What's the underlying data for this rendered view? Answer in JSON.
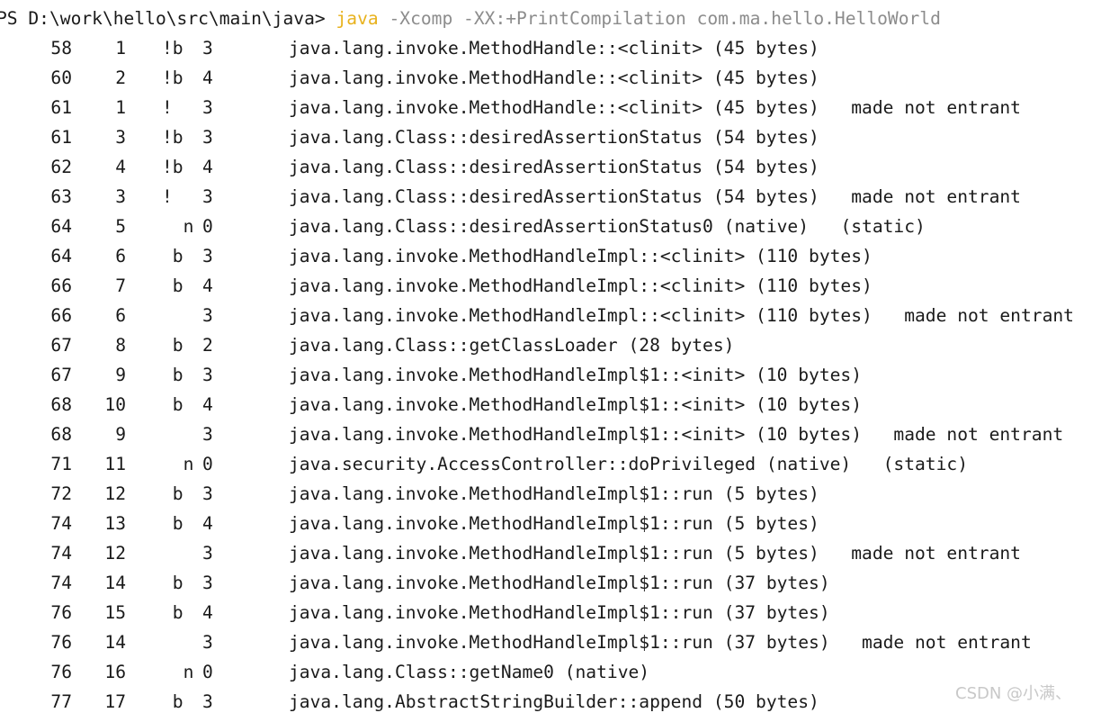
{
  "command": {
    "prompt": "PS D:\\work\\hello\\src\\main\\java> ",
    "exe": "java",
    "args": " -Xcomp -XX:+PrintCompilation com.ma.hello.HelloWorld"
  },
  "rows": [
    {
      "ts": "58",
      "id": "1",
      "attr": "!b",
      "tier": "3",
      "method": "java.lang.invoke.MethodHandle::<clinit> (45 bytes)",
      "note": ""
    },
    {
      "ts": "60",
      "id": "2",
      "attr": "!b",
      "tier": "4",
      "method": "java.lang.invoke.MethodHandle::<clinit> (45 bytes)",
      "note": ""
    },
    {
      "ts": "61",
      "id": "1",
      "attr": "!",
      "tier": "3",
      "method": "java.lang.invoke.MethodHandle::<clinit> (45 bytes)",
      "note": "made not entrant"
    },
    {
      "ts": "61",
      "id": "3",
      "attr": "!b",
      "tier": "3",
      "method": "java.lang.Class::desiredAssertionStatus (54 bytes)",
      "note": ""
    },
    {
      "ts": "62",
      "id": "4",
      "attr": "!b",
      "tier": "4",
      "method": "java.lang.Class::desiredAssertionStatus (54 bytes)",
      "note": ""
    },
    {
      "ts": "63",
      "id": "3",
      "attr": "!",
      "tier": "3",
      "method": "java.lang.Class::desiredAssertionStatus (54 bytes)",
      "note": "made not entrant"
    },
    {
      "ts": "64",
      "id": "5",
      "attr": "  n",
      "tier": "0",
      "method": "java.lang.Class::desiredAssertionStatus0 (native)",
      "note": "(static)"
    },
    {
      "ts": "64",
      "id": "6",
      "attr": " b",
      "tier": "3",
      "method": "java.lang.invoke.MethodHandleImpl::<clinit> (110 bytes)",
      "note": ""
    },
    {
      "ts": "66",
      "id": "7",
      "attr": " b",
      "tier": "4",
      "method": "java.lang.invoke.MethodHandleImpl::<clinit> (110 bytes)",
      "note": ""
    },
    {
      "ts": "66",
      "id": "6",
      "attr": "",
      "tier": "3",
      "method": "java.lang.invoke.MethodHandleImpl::<clinit> (110 bytes)",
      "note": "made not entrant"
    },
    {
      "ts": "67",
      "id": "8",
      "attr": " b",
      "tier": "2",
      "method": "java.lang.Class::getClassLoader (28 bytes)",
      "note": ""
    },
    {
      "ts": "67",
      "id": "9",
      "attr": " b",
      "tier": "3",
      "method": "java.lang.invoke.MethodHandleImpl$1::<init> (10 bytes)",
      "note": ""
    },
    {
      "ts": "68",
      "id": "10",
      "attr": " b",
      "tier": "4",
      "method": "java.lang.invoke.MethodHandleImpl$1::<init> (10 bytes)",
      "note": ""
    },
    {
      "ts": "68",
      "id": "9",
      "attr": "",
      "tier": "3",
      "method": "java.lang.invoke.MethodHandleImpl$1::<init> (10 bytes)",
      "note": "made not entrant"
    },
    {
      "ts": "71",
      "id": "11",
      "attr": "  n",
      "tier": "0",
      "method": "java.security.AccessController::doPrivileged (native)",
      "note": "(static)"
    },
    {
      "ts": "72",
      "id": "12",
      "attr": " b",
      "tier": "3",
      "method": "java.lang.invoke.MethodHandleImpl$1::run (5 bytes)",
      "note": ""
    },
    {
      "ts": "74",
      "id": "13",
      "attr": " b",
      "tier": "4",
      "method": "java.lang.invoke.MethodHandleImpl$1::run (5 bytes)",
      "note": ""
    },
    {
      "ts": "74",
      "id": "12",
      "attr": "",
      "tier": "3",
      "method": "java.lang.invoke.MethodHandleImpl$1::run (5 bytes)",
      "note": "made not entrant"
    },
    {
      "ts": "74",
      "id": "14",
      "attr": " b",
      "tier": "3",
      "method": "java.lang.invoke.MethodHandleImpl$1::run (37 bytes)",
      "note": ""
    },
    {
      "ts": "76",
      "id": "15",
      "attr": " b",
      "tier": "4",
      "method": "java.lang.invoke.MethodHandleImpl$1::run (37 bytes)",
      "note": ""
    },
    {
      "ts": "76",
      "id": "14",
      "attr": "",
      "tier": "3",
      "method": "java.lang.invoke.MethodHandleImpl$1::run (37 bytes)",
      "note": "made not entrant"
    },
    {
      "ts": "76",
      "id": "16",
      "attr": "  n",
      "tier": "0",
      "method": "java.lang.Class::getName0 (native)",
      "note": ""
    },
    {
      "ts": "77",
      "id": "17",
      "attr": " b",
      "tier": "3",
      "method": "java.lang.AbstractStringBuilder::append (50 bytes)",
      "note": ""
    }
  ],
  "watermark": "CSDN @小满、",
  "colors": {
    "background": "#ffffff",
    "text": "#1a1a1a",
    "command_exe": "#e8b21d",
    "command_args": "#8c8c8c"
  }
}
